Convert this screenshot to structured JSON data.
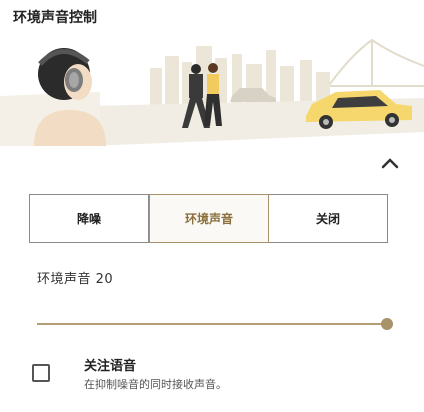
{
  "header": {
    "title": "环境声音控制"
  },
  "illustration": {
    "icon": "ambient-sound-scene"
  },
  "collapse": {
    "icon": "chevron-up-icon"
  },
  "modes": {
    "items": [
      {
        "label": "降噪"
      },
      {
        "label": "环境声音"
      },
      {
        "label": "关闭"
      }
    ],
    "selected": "环境声音"
  },
  "ambient_level": {
    "label": "环境声音 20",
    "value": 20,
    "max": 20
  },
  "focus_voice": {
    "title": "关注语音",
    "description": "在抑制噪音的同时接收声音。",
    "checked": false
  },
  "colors": {
    "accent": "#a8926a",
    "taxi": "#f5d76e"
  }
}
